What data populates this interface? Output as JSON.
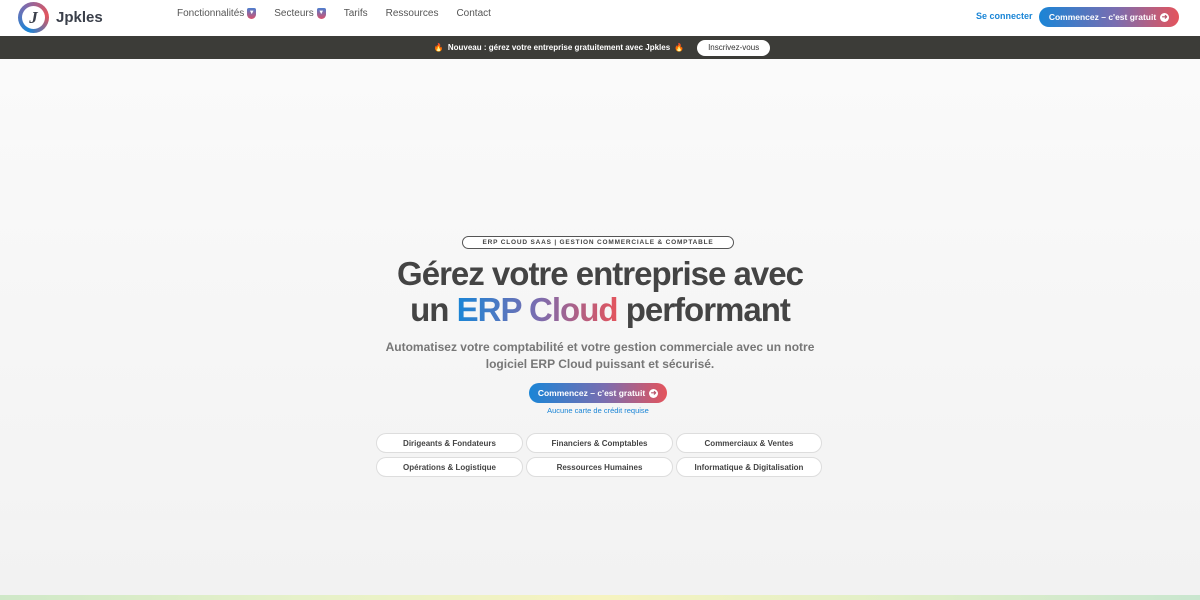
{
  "brand": {
    "logo_letter": "J",
    "name": "Jpkles"
  },
  "nav": {
    "items": [
      {
        "label": "Fonctionnalités",
        "dropdown": true
      },
      {
        "label": "Secteurs",
        "dropdown": true
      },
      {
        "label": "Tarifs",
        "dropdown": false
      },
      {
        "label": "Ressources",
        "dropdown": false
      },
      {
        "label": "Contact",
        "dropdown": false
      }
    ],
    "login": "Se connecter",
    "cta": "Commencez – c'est gratuit"
  },
  "announcement": {
    "text": "Nouveau : gérez votre entreprise gratuitement avec Jpkles",
    "button": "Inscrivez-vous"
  },
  "hero": {
    "badge": "ERP CLOUD SAAS | GESTION COMMERCIALE & COMPTABLE",
    "title_line1": "Gérez votre entreprise avec",
    "title_un": "un",
    "title_highlight": "ERP Cloud",
    "title_end": "performant",
    "subtitle": "Automatisez votre comptabilité et votre gestion commerciale avec un notre logiciel ERP Cloud puissant et sécurisé.",
    "cta": "Commencez – c'est gratuit",
    "note": "Aucune carte de crédit requise",
    "audiences": [
      "Dirigeants & Fondateurs",
      "Financiers & Comptables",
      "Commerciaux & Ventes",
      "Opérations & Logistique",
      "Ressources Humaines",
      "Informatique & Digitalisation"
    ]
  },
  "colors": {
    "brand_blue": "#1a85d6",
    "brand_red": "#e4545c",
    "announce_bg": "#3c3c38"
  }
}
